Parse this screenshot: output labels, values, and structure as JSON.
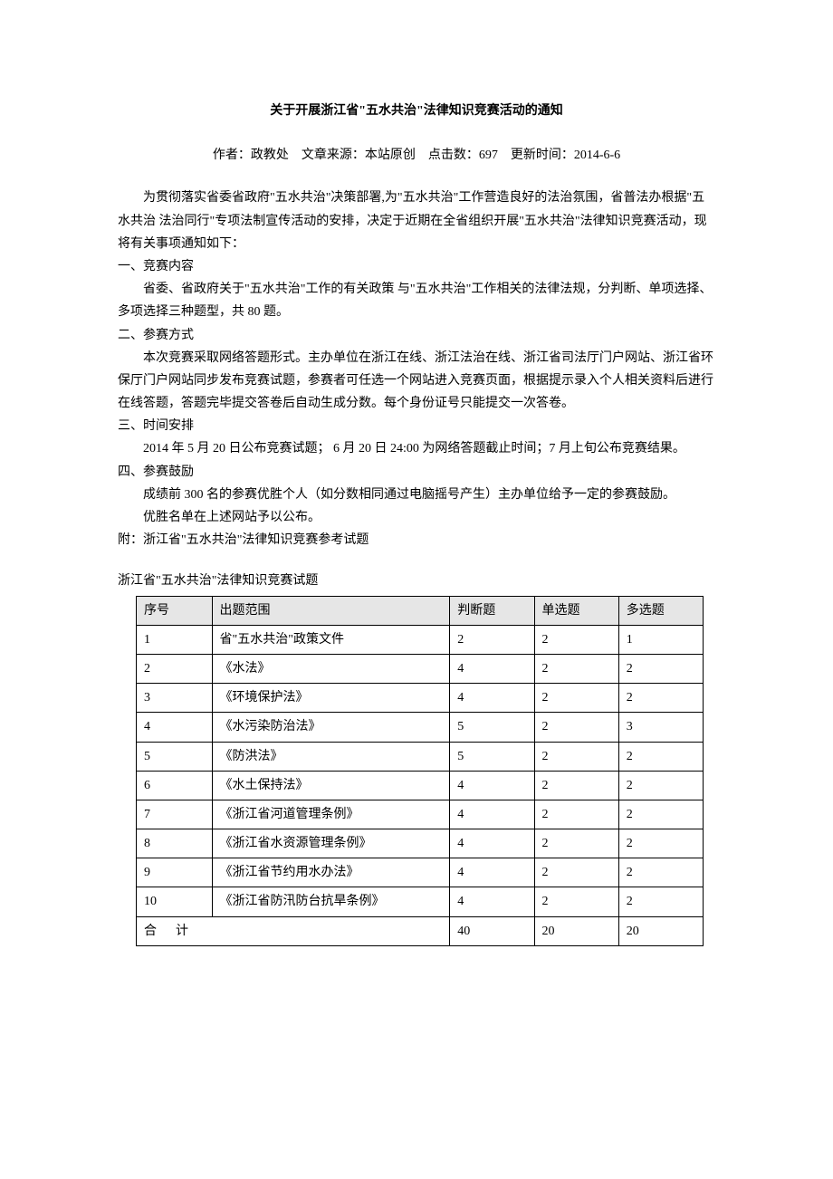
{
  "title": "关于开展浙江省\"五水共治\"法律知识竞赛活动的通知",
  "meta": {
    "author_label": "作者：",
    "author": "政教处",
    "source_label": "文章来源：",
    "source": "本站原创",
    "hits_label": "点击数：",
    "hits": "697",
    "update_label": "更新时间：",
    "update": "2014-6-6"
  },
  "paras": {
    "p1": "为贯彻落实省委省政府\"五水共治\"决策部署,为\"五水共治\"工作营造良好的法治氛围，省普法办根据\"五水共治 法治同行\"专项法制宣传活动的安排，决定于近期在全省组织开展\"五水共治\"法律知识竞赛活动，现将有关事项通知如下：",
    "h1": "一、竞赛内容",
    "p2": "省委、省政府关于\"五水共治\"工作的有关政策 与\"五水共治\"工作相关的法律法规，分判断、单项选择、多项选择三种题型，共 80 题。",
    "h2": "二、参赛方式",
    "p3": "本次竞赛采取网络答题形式。主办单位在浙江在线、浙江法治在线、浙江省司法厅门户网站、浙江省环保厅门户网站同步发布竞赛试题，参赛者可任选一个网站进入竞赛页面，根据提示录入个人相关资料后进行在线答题，答题完毕提交答卷后自动生成分数。每个身份证号只能提交一次答卷。",
    "h3": "三、时间安排",
    "p4": "2014 年 5 月 20 日公布竞赛试题； 6 月 20 日 24:00 为网络答题截止时间；7 月上旬公布竞赛结果。",
    "h4": "四、参赛鼓励",
    "p5": "成绩前 300 名的参赛优胜个人（如分数相同通过电脑摇号产生）主办单位给予一定的参赛鼓励。",
    "p6": "优胜名单在上述网站予以公布。",
    "attach": "附：浙江省\"五水共治\"法律知识竞赛参考试题",
    "table_title": "浙江省\"五水共治\"法律知识竞赛试题"
  },
  "table": {
    "headers": {
      "idx": "序号",
      "scope": "出题范围",
      "judge": "判断题",
      "single": "单选题",
      "multi": "多选题"
    },
    "rows": [
      {
        "idx": "1",
        "scope": "省\"五水共治\"政策文件",
        "judge": "2",
        "single": "2",
        "multi": "1"
      },
      {
        "idx": "2",
        "scope": "《水法》",
        "judge": "4",
        "single": "2",
        "multi": "2"
      },
      {
        "idx": "3",
        "scope": "《环境保护法》",
        "judge": "4",
        "single": "2",
        "multi": "2"
      },
      {
        "idx": "4",
        "scope": "《水污染防治法》",
        "judge": "5",
        "single": "2",
        "multi": "3"
      },
      {
        "idx": "5",
        "scope": "《防洪法》",
        "judge": "5",
        "single": "2",
        "multi": "2"
      },
      {
        "idx": "6",
        "scope": "《水土保持法》",
        "judge": "4",
        "single": "2",
        "multi": "2"
      },
      {
        "idx": "7",
        "scope": "《浙江省河道管理条例》",
        "judge": "4",
        "single": "2",
        "multi": "2"
      },
      {
        "idx": "8",
        "scope": "《浙江省水资源管理条例》",
        "judge": "4",
        "single": "2",
        "multi": "2"
      },
      {
        "idx": "9",
        "scope": "《浙江省节约用水办法》",
        "judge": "4",
        "single": "2",
        "multi": "2"
      },
      {
        "idx": "10",
        "scope": "《浙江省防汛防台抗旱条例》",
        "judge": "4",
        "single": "2",
        "multi": "2"
      }
    ],
    "total": {
      "label": "合计",
      "judge": "40",
      "single": "20",
      "multi": "20"
    }
  }
}
